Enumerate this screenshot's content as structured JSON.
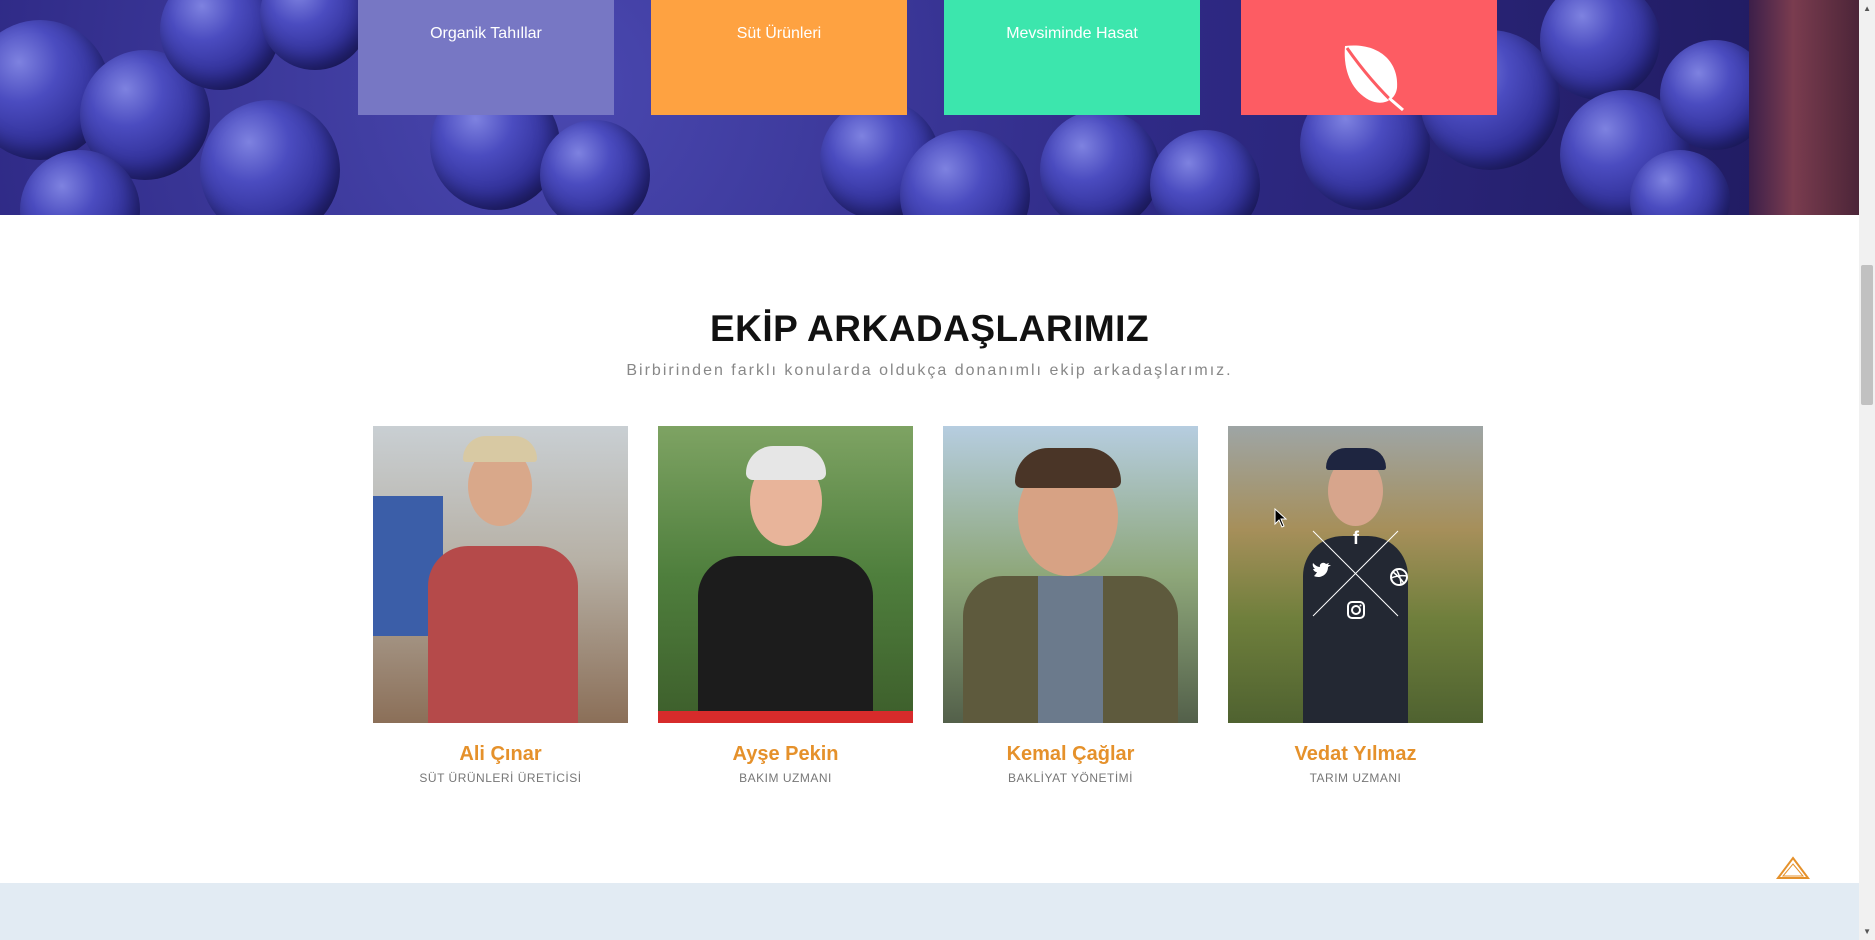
{
  "features": [
    {
      "label": "Organik Tahıllar",
      "color": "#7777c4"
    },
    {
      "label": "Süt Ürünleri",
      "color": "#fea241"
    },
    {
      "label": "Mevsiminde Hasat",
      "color": "#3ce6ad"
    },
    {
      "label": "",
      "icon": "leaf-icon",
      "color": "#fd5c63"
    }
  ],
  "team": {
    "title": "EKİP ARKADAŞLARIMIZ",
    "subtitle": "Birbirinden farklı konularda oldukça donanımlı ekip arkadaşlarımız.",
    "members": [
      {
        "name": "Ali Çınar",
        "role": "SÜT ÜRÜNLERİ ÜRETİCİSİ"
      },
      {
        "name": "Ayşe Pekin",
        "role": "BAKIM UZMANI"
      },
      {
        "name": "Kemal Çağlar",
        "role": "BAKLİYAT YÖNETİMİ"
      },
      {
        "name": "Vedat Yılmaz",
        "role": "TARIM UZMANI"
      }
    ],
    "social_icons": [
      "facebook-icon",
      "twitter-icon",
      "dribbble-icon",
      "instagram-icon"
    ]
  },
  "colors": {
    "accent": "#e5912b",
    "bottom_band": "#e2ebf3"
  }
}
